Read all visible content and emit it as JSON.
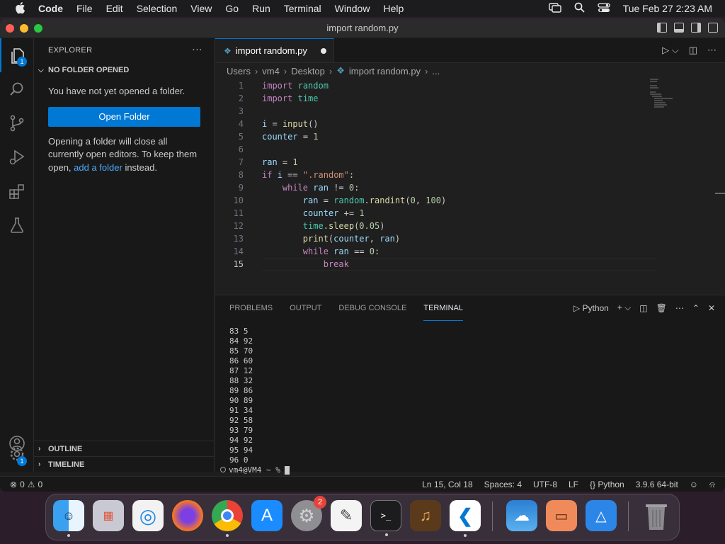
{
  "menubar": {
    "app": "Code",
    "items": [
      "File",
      "Edit",
      "Selection",
      "View",
      "Go",
      "Run",
      "Terminal",
      "Window",
      "Help"
    ],
    "clock": "Tue Feb 27  2:23 AM"
  },
  "window": {
    "title": "import random.py"
  },
  "activity": {
    "explorer_badge": "1",
    "manage_badge": "1"
  },
  "sidebar": {
    "header": "EXPLORER",
    "more": "···",
    "section": "NO FOLDER OPENED",
    "message": "You have not yet opened a folder.",
    "open_button": "Open Folder",
    "note_1": "Opening a folder will close all currently open editors. To keep them open, ",
    "note_link": "add a folder",
    "note_2": " instead.",
    "outline": "OUTLINE",
    "timeline": "TIMELINE"
  },
  "editor": {
    "tab": "import random.py",
    "breadcrumb": [
      "Users",
      "vm4",
      "Desktop",
      "import random.py",
      "..."
    ],
    "current_line": 15
  },
  "code_lines": [
    "import random",
    "import time",
    "",
    "i = input()",
    "counter = 1",
    "",
    "ran = 1",
    "if i == \".random\":",
    "    while ran != 0:",
    "        ran = random.randint(0, 100)",
    "        counter += 1",
    "        time.sleep(0.05)",
    "        print(counter, ran)",
    "        while ran == 0:",
    "            break"
  ],
  "panel": {
    "tabs": [
      "PROBLEMS",
      "OUTPUT",
      "DEBUG CONSOLE",
      "TERMINAL"
    ],
    "active_tab": "TERMINAL",
    "shell": "Python",
    "terminal_lines": [
      "83 5",
      "84 92",
      "85 70",
      "86 60",
      "87 12",
      "88 32",
      "89 86",
      "90 89",
      "91 34",
      "92 58",
      "93 79",
      "94 92",
      "95 94",
      "96 0"
    ],
    "prompt": "vm4@VM4 ~ % "
  },
  "status": {
    "errors": "0",
    "warnings": "0",
    "position": "Ln 15, Col 18",
    "spaces": "Spaces: 4",
    "encoding": "UTF-8",
    "eol": "LF",
    "language": "Python",
    "interpreter": "3.9.6 64-bit"
  },
  "dock": {
    "settings_badge": "2"
  },
  "colors": {
    "accent": "#0078d4",
    "link": "#4daafc"
  }
}
